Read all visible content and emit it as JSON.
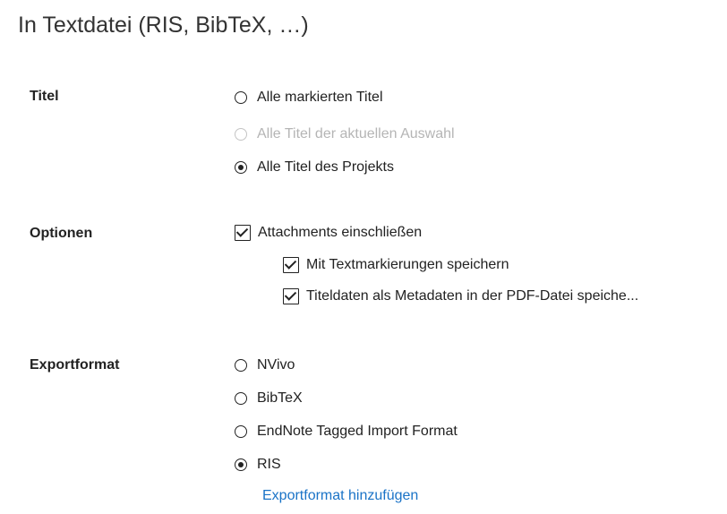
{
  "dialog": {
    "title": "In Textdatei (RIS, BibTeX, …)"
  },
  "titel": {
    "label": "Titel",
    "options": [
      {
        "label": "Alle markierten Titel",
        "checked": false,
        "disabled": false
      },
      {
        "label": "Alle Titel der aktuellen Auswahl",
        "checked": false,
        "disabled": true
      },
      {
        "label": "Alle Titel des Projekts",
        "checked": true,
        "disabled": false
      }
    ]
  },
  "optionen": {
    "label": "Optionen",
    "attachments": {
      "label": "Attachments einschließen",
      "checked": true
    },
    "textmarkierungen": {
      "label": "Mit Textmarkierungen speichern",
      "checked": true
    },
    "metadaten": {
      "label": "Titeldaten als Metadaten in der PDF-Datei speiche...",
      "checked": true
    }
  },
  "exportformat": {
    "label": "Exportformat",
    "options": [
      {
        "label": "NVivo",
        "checked": false
      },
      {
        "label": "BibTeX",
        "checked": false
      },
      {
        "label": "EndNote Tagged Import Format",
        "checked": false
      },
      {
        "label": "RIS",
        "checked": true
      }
    ],
    "add_link": "Exportformat hinzufügen"
  },
  "colors": {
    "link": "#1a73c7",
    "disabled_text": "#b5b5b5"
  }
}
